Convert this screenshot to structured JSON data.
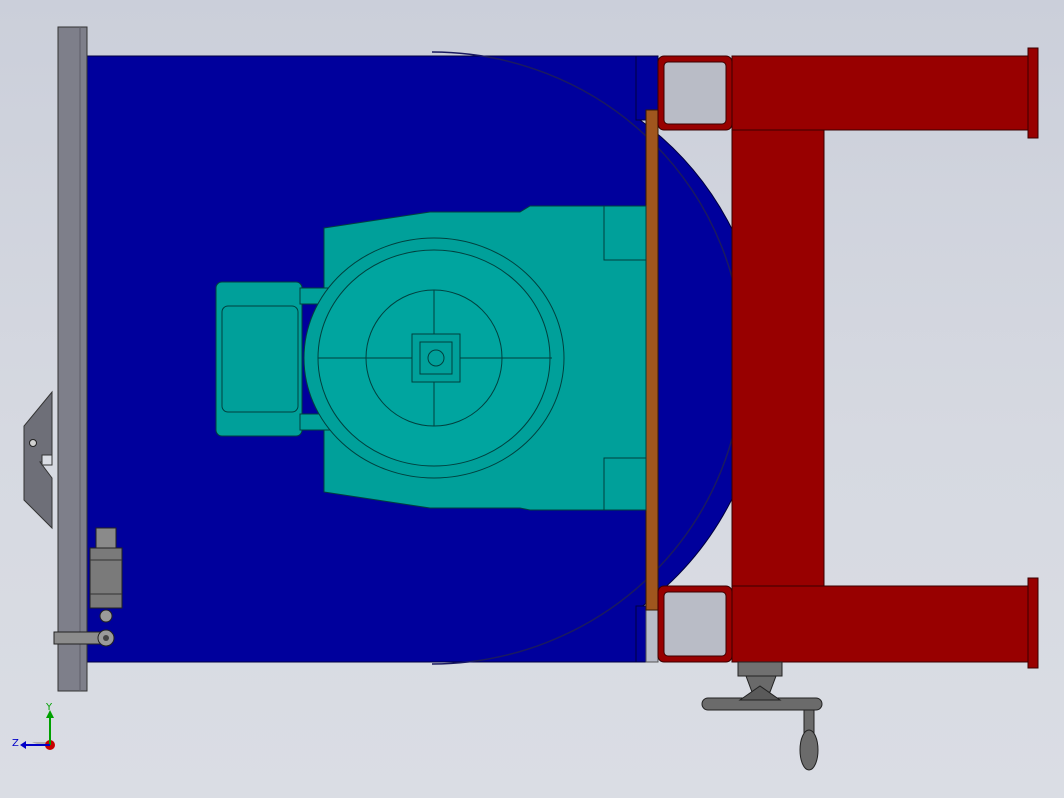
{
  "viewport": {
    "background": "#d4d7df"
  },
  "triad": {
    "y_label": "Y",
    "z_label": "Z",
    "y_color": "#00a000",
    "z_color": "#0000c8",
    "x_color": "#c80000"
  },
  "colors": {
    "blue_plate": "#00009c",
    "teal_motor": "#00a09a",
    "red_frame": "#980000",
    "gray_bar": "#7e7f8a",
    "brown_strip": "#a0561e",
    "dark_gray": "#5a5a5a",
    "handwheel": "#6b6b6b"
  },
  "icons": [
    "coordinate-triad-icon"
  ]
}
